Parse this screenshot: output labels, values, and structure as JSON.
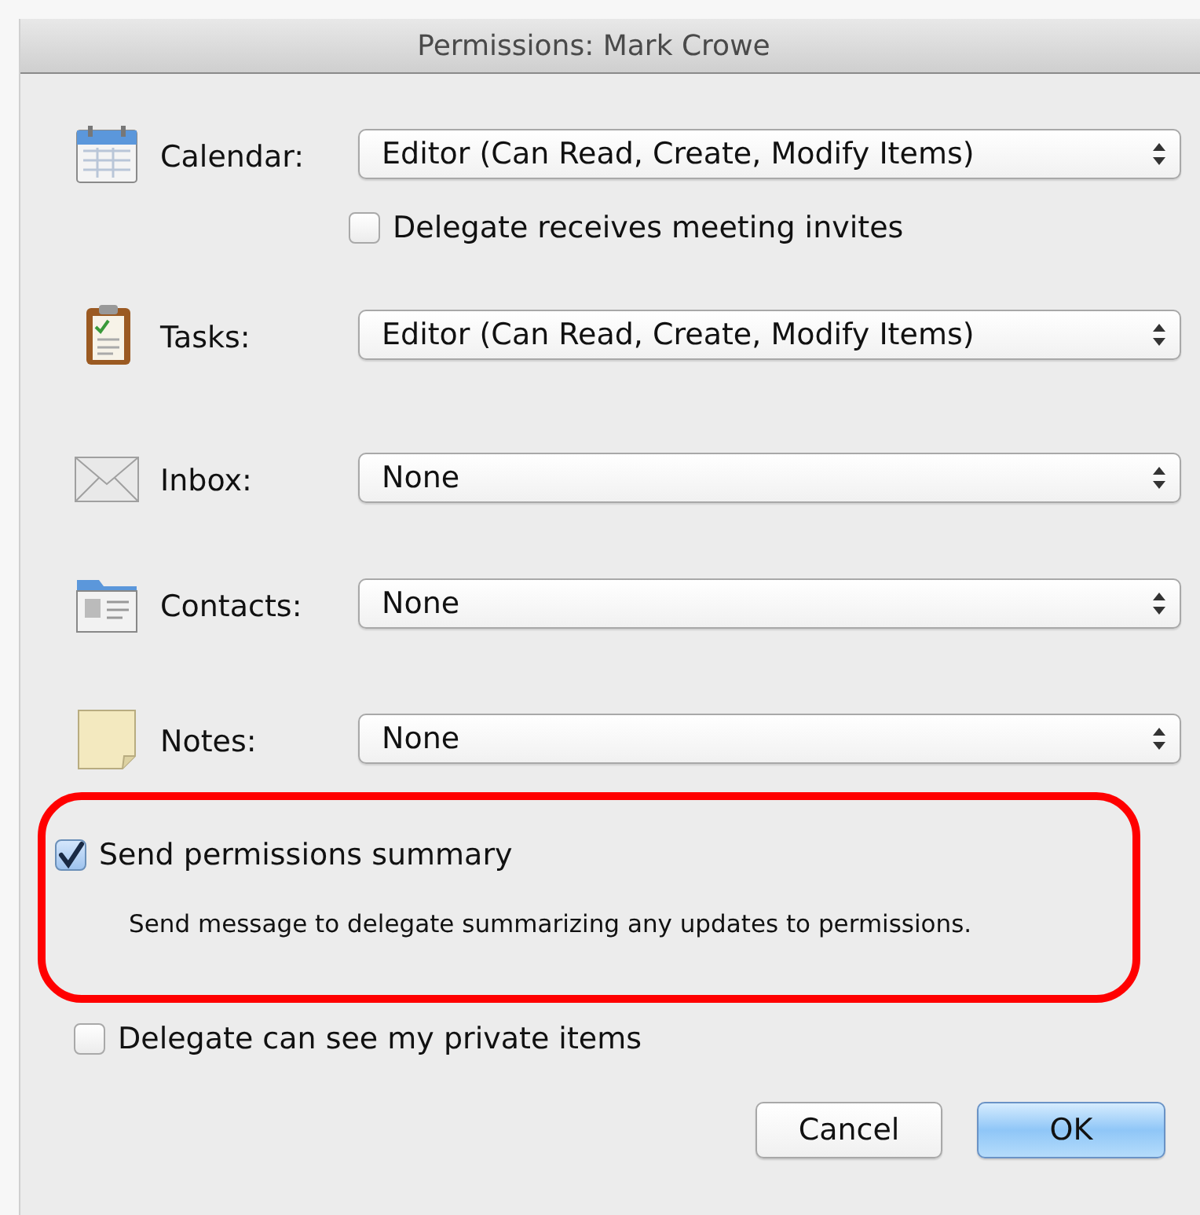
{
  "window": {
    "title": "Permissions: Mark Crowe"
  },
  "permissions": [
    {
      "label": "Calendar:",
      "value": "Editor (Can Read, Create, Modify Items)",
      "option": {
        "label": "Delegate receives meeting invites",
        "checked": false
      }
    },
    {
      "label": "Tasks:",
      "value": "Editor (Can Read, Create, Modify Items)"
    },
    {
      "label": "Inbox:",
      "value": "None"
    },
    {
      "label": "Contacts:",
      "value": "None"
    },
    {
      "label": "Notes:",
      "value": "None"
    }
  ],
  "summary": {
    "label": "Send permissions summary",
    "checked": true,
    "highlighted": true,
    "description": "Send message to delegate summarizing any updates to permissions."
  },
  "private_items": {
    "label": "Delegate can see my private items",
    "checked": false
  },
  "buttons": [
    {
      "label": "Cancel",
      "default": false
    },
    {
      "label": "OK",
      "default": true
    }
  ]
}
